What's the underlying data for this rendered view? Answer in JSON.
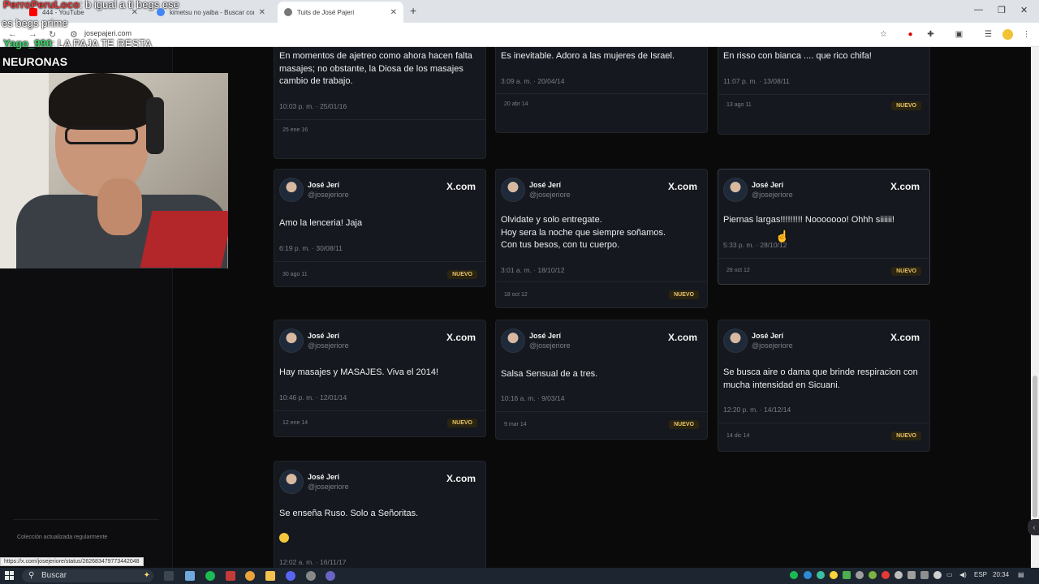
{
  "browser": {
    "tabs": [
      {
        "title": "444 - YouTube"
      },
      {
        "title": "kimetsu no yaiba - Buscar con G"
      },
      {
        "title": "Tuits de José Pajerí"
      }
    ],
    "url": "josepajeri.com",
    "status_url": "https://x.com/josejeriore/status/262683479773442048"
  },
  "overlay": {
    "chat1_name": "PerroPeruLoco",
    "chat1_msg": ": b igual a ti begs ese",
    "chat1_cont": "es begs prime",
    "chat2_name": "Yago_990",
    "chat2_msg": ": LA PAJA TE RESTA",
    "chat2_cont": "NEURONAS"
  },
  "sidebar": {
    "footer": "Colección actualizada regularmente"
  },
  "tweets": [
    {
      "name": "",
      "handle": "",
      "text": "En momentos de ajetreo como ahora hacen falta masajes; no obstante, la Diosa de los masajes cambio de trabajo.",
      "time": "10:03 p. m. · 25/01/16",
      "date": "25 ene 16",
      "badge": ""
    },
    {
      "name": "",
      "handle": "",
      "text": "Es inevitable. Adoro a las mujeres de Israel.",
      "time": "3:09 a. m. · 20/04/14",
      "date": "20 abr 14",
      "badge": ""
    },
    {
      "name": "",
      "handle": "",
      "text": "En risso con bianca .... que rico chifa!",
      "time": "11:07 p. m. · 13/08/11",
      "date": "13 ago 11",
      "badge": "NUEVO"
    },
    {
      "name": "José Jerí",
      "handle": "@josejeriore",
      "site": "X.com",
      "text": "Amo la lenceria! Jaja",
      "time": "6:19 p. m. · 30/08/11",
      "date": "30 ago 11",
      "badge": "NUEVO"
    },
    {
      "name": "José Jerí",
      "handle": "@josejeriore",
      "site": "X.com",
      "text": "Olvidate y solo entregate.\nHoy sera la noche que siempre soñamos.\nCon tus besos, con tu cuerpo.",
      "time": "3:01 a. m. · 18/10/12",
      "date": "18 oct 12",
      "badge": "NUEVO"
    },
    {
      "name": "José Jerí",
      "handle": "@josejeriore",
      "site": "X.com",
      "text": "Piernas largas!!!!!!!!! Nooooooo! Ohhh siiiiii!",
      "time": "5:33 p. m. · 28/10/12",
      "date": "28 oct 12",
      "badge": "NUEVO"
    },
    {
      "name": "José Jerí",
      "handle": "@josejeriore",
      "site": "X.com",
      "text": "Hay masajes y MASAJES. Viva el 2014!",
      "time": "10:46 p. m. · 12/01/14",
      "date": "12 ene 14",
      "badge": "NUEVO"
    },
    {
      "name": "José Jerí",
      "handle": "@josejeriore",
      "site": "X.com",
      "text": "Salsa Sensual de a tres.",
      "time": "10:16 a. m. · 9/03/14",
      "date": "9 mar 14",
      "badge": "NUEVO"
    },
    {
      "name": "José Jerí",
      "handle": "@josejeriore",
      "site": "X.com",
      "text": "Se busca aire o dama que brinde respiracion con mucha intensidad en Sicuani.",
      "time": "12:20 p. m. · 14/12/14",
      "date": "14 dic 14",
      "badge": "NUEVO"
    },
    {
      "name": "José Jerí",
      "handle": "@josejeriore",
      "site": "X.com",
      "text": "Se enseña Ruso. Solo a Señoritas.",
      "time": "12:02 a. m. · 16/11/17",
      "date": "",
      "badge": ""
    }
  ],
  "taskbar": {
    "search": "Buscar",
    "lang": "ESP",
    "clock": "20:34"
  }
}
